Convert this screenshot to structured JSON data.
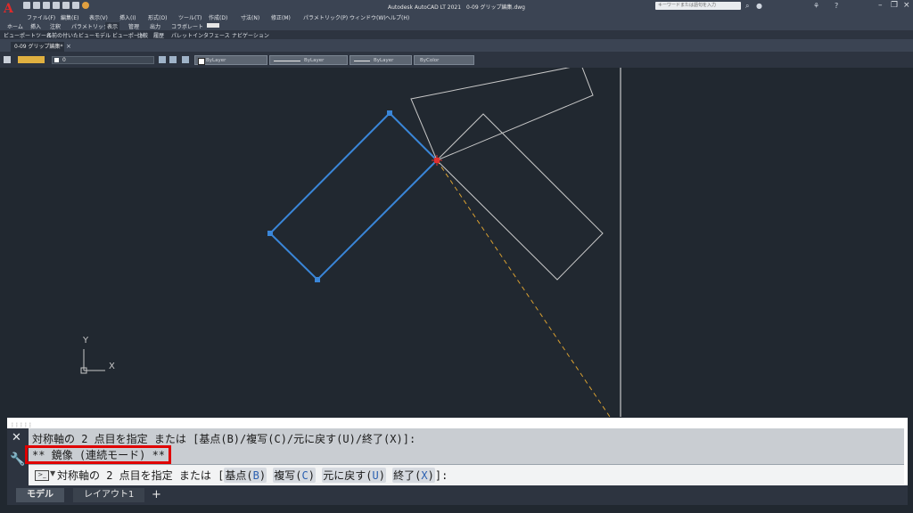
{
  "titlebar": {
    "app_logo": "A",
    "title": "Autodesk AutoCAD LT 2021　0-09 グリップ編集.dwg",
    "search_placeholder": "キーワードまたは語句を入力",
    "icons": [
      "open-icon",
      "save-icon",
      "print-icon",
      "undo-icon",
      "redo-icon",
      "search-icon",
      "user-icon",
      "share-icon",
      "help-icon"
    ]
  },
  "menubar": {
    "items": [
      "ファイル(F)",
      "編集(E)",
      "表示(V)",
      "挿入(I)",
      "形式(O)",
      "ツール(T)",
      "作成(D)",
      "寸法(N)",
      "修正(M)",
      "パラメトリック(P)",
      "ウィンドウ(W)",
      "ヘルプ(H)"
    ]
  },
  "ribbon_tabs": {
    "items": [
      "ホーム",
      "挿入",
      "注釈",
      "パラメトリック",
      "表示",
      "管理",
      "出力",
      "コラボレート"
    ],
    "active": "表示"
  },
  "ribbon_panels": {
    "items": [
      "ビューポートツール",
      "名前の付いたビュー",
      "モデル ビューポート",
      "比較",
      "履歴",
      "パレット",
      "インタフェース",
      "ナビゲーション"
    ]
  },
  "file_tabs": {
    "active_label": "0-09 グリップ編集*"
  },
  "properties_bar": {
    "layer_name": "0",
    "color": "ByLayer",
    "linetype": "ByLayer",
    "lineweight": "ByLayer",
    "plotstyle": "ByColor"
  },
  "canvas": {
    "background": "#212830",
    "selected_color": "#3a86d8",
    "ghost_color": "#c8c8c8",
    "mirror_line_color": "#d9a030",
    "ucs_x_label": "X",
    "ucs_y_label": "Y"
  },
  "command": {
    "history_line1": "対称軸の 2 点目を指定 または [基点(B)/複写(C)/元に戻す(U)/終了(X)]:",
    "history_line2": "** 鏡像 (連続モード) **",
    "prompt_prefix": "対称軸の 2 点目を指定 または [",
    "options": [
      {
        "label": "基点(",
        "key": "B",
        "close": ")"
      },
      {
        "label": "複写(",
        "key": "C",
        "close": ")"
      },
      {
        "label": "元に戻す(",
        "key": "U",
        "close": ")"
      },
      {
        "label": "終了(",
        "key": "X",
        "close": ")"
      }
    ],
    "prompt_suffix": "]:",
    "highlight_color": "#e00000"
  },
  "layout_tabs": {
    "model": "モデル",
    "layout1": "レイアウト1",
    "add": "+"
  }
}
